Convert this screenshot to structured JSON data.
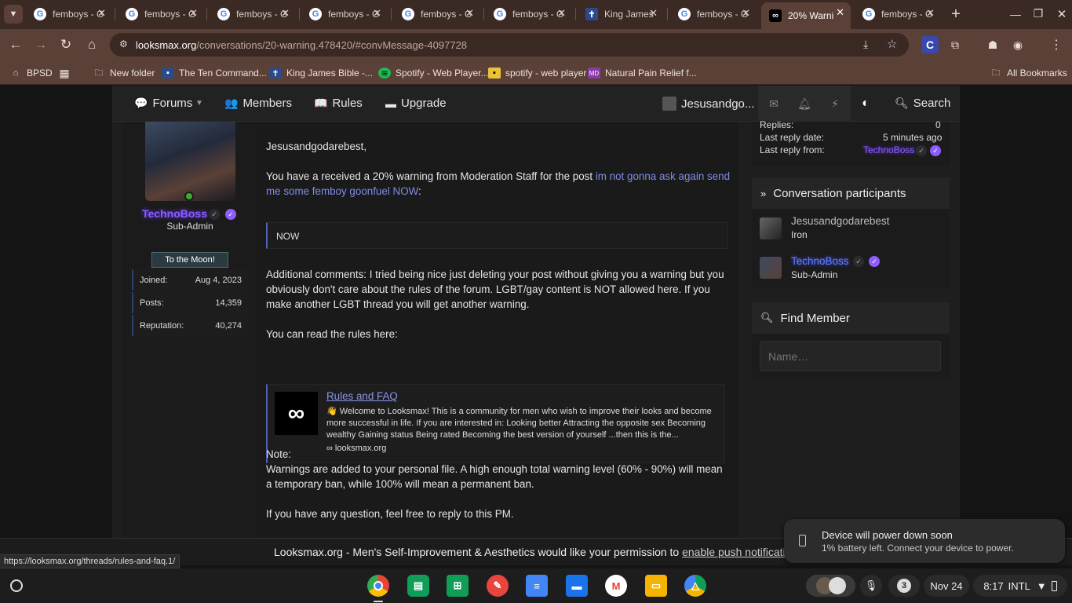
{
  "browser": {
    "tabs": [
      {
        "label": "femboys - G",
        "icon": "google-icon",
        "active": false
      },
      {
        "label": "femboys - G",
        "icon": "google-icon",
        "active": false
      },
      {
        "label": "femboys - G",
        "icon": "google-icon",
        "active": false
      },
      {
        "label": "femboys - G",
        "icon": "google-icon",
        "active": false
      },
      {
        "label": "femboys - G",
        "icon": "google-icon",
        "active": false
      },
      {
        "label": "femboys - G",
        "icon": "google-icon",
        "active": false
      },
      {
        "label": "King James",
        "icon": "cross-icon",
        "active": false
      },
      {
        "label": "femboys - G",
        "icon": "google-icon",
        "active": false
      },
      {
        "label": "20% Warni",
        "icon": "infinity-icon",
        "active": true
      },
      {
        "label": "femboys - G",
        "icon": "google-icon",
        "active": false
      }
    ],
    "url_host": "looksmax.org",
    "url_path": "/conversations/20-warning.478420/#convMessage-4097728",
    "profile_letter": "C",
    "bookmarks": [
      {
        "label": "BPSD",
        "icon": "bpsd-icon"
      },
      {
        "label": "",
        "icon": "apps-grid-icon"
      },
      {
        "label": "New folder",
        "icon": "folder-icon"
      },
      {
        "label": "The Ten Command...",
        "icon": "page-icon"
      },
      {
        "label": "King James Bible -...",
        "icon": "cross-icon"
      },
      {
        "label": "Spotify - Web Player...",
        "icon": "spotify-icon"
      },
      {
        "label": "spotify - web player",
        "icon": "page-icon"
      },
      {
        "label": "Natural Pain Relief f...",
        "icon": "md-icon"
      }
    ],
    "all_bookmarks": "All Bookmarks"
  },
  "site_nav": {
    "forums": "Forums",
    "members": "Members",
    "rules": "Rules",
    "upgrade": "Upgrade",
    "account": "Jesusandgo...",
    "search": "Search"
  },
  "author": {
    "name": "TechnoBoss",
    "title": "Sub-Admin",
    "banner": "To the Moon!",
    "stats": [
      {
        "label": "Joined:",
        "value": "Aug 4, 2023"
      },
      {
        "label": "Posts:",
        "value": "14,359"
      },
      {
        "label": "Reputation:",
        "value": "40,274"
      }
    ]
  },
  "message": {
    "greeting": "Jesusandgodarebest,",
    "intro": "You have a received a 20% warning from Moderation Staff for the post ",
    "post_link": "im not gonna ask again send me some femboy goonfuel NOW",
    "intro_end": ":",
    "quote": "NOW",
    "comments": "Additional comments: I tried being nice just deleting your post without giving you a warning but you obviously don't care about the rules of the forum. LGBT/gay content is NOT allowed here. If you make another LGBT thread you will get another warning.",
    "rules_intro": "You can read the rules here:",
    "unfurl": {
      "title": "Rules and FAQ",
      "description": "👋 Welcome to Looksmax! This is a community for men who wish to improve their looks and become more successful in life. If you are interested in: Looking better Attracting the opposite sex Becoming wealthy Gaining status Being rated Becoming the best version of yourself ...then this is the...",
      "site": "looksmax.org"
    },
    "note_label": "Note:",
    "note": "Warnings are added to your personal file. A high enough total warning level (60% - 90%) will mean a temporary ban, while 100% will mean a permanent ban.",
    "closing": "If you have any question, feel free to reply to this PM."
  },
  "sidebar": {
    "replies_label": "Replies:",
    "replies_value": "0",
    "last_reply_date_label": "Last reply date:",
    "last_reply_date_value": "5 minutes ago",
    "last_reply_from_label": "Last reply from:",
    "last_reply_from_value": "TechnoBoss",
    "participants_title": "Conversation participants",
    "participants": [
      {
        "name": "Jesusandgodarebest",
        "title": "Iron"
      },
      {
        "name": "TechnoBoss",
        "title": "Sub-Admin"
      }
    ],
    "find_member_title": "Find Member",
    "find_member_placeholder": "Name…"
  },
  "push_notice": {
    "text": "Looksmax.org - Men's Self-Improvement & Aesthetics would like your permission to ",
    "link": "enable push notifications"
  },
  "status_url": "https://looksmax.org/threads/rules-and-faq.1/",
  "toast": {
    "title": "Device will power down soon",
    "subtitle": "1% battery left. Connect your device to power."
  },
  "shelf": {
    "notification_count": "3",
    "date": "Nov 24",
    "time": "8:17",
    "input_method": "INTL"
  }
}
